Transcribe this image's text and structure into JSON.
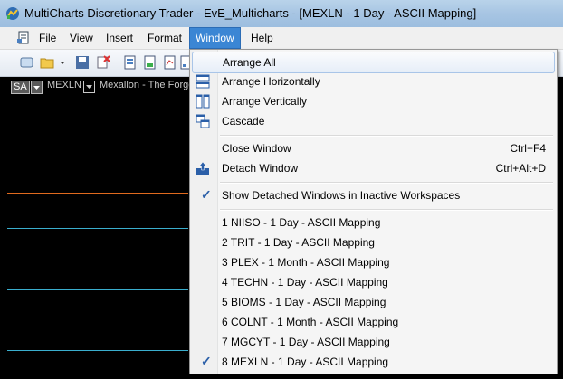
{
  "window": {
    "title": "MultiCharts Discretionary Trader - EvE_Multicharts - [MEXLN - 1 Day - ASCII Mapping]"
  },
  "menubar": {
    "items": [
      {
        "label": "File"
      },
      {
        "label": "View"
      },
      {
        "label": "Insert"
      },
      {
        "label": "Format"
      },
      {
        "label": "Window"
      },
      {
        "label": "Help"
      }
    ]
  },
  "chart": {
    "mode_badge": "SA",
    "symbol": "MEXLN",
    "symbol_description": "Mexallon - The Forge"
  },
  "window_menu": {
    "items": [
      {
        "label": "Arrange All",
        "icon": "arrange-all-icon"
      },
      {
        "label": "Arrange Horizontally",
        "icon": "arrange-horizontal-icon"
      },
      {
        "label": "Arrange Vertically",
        "icon": "arrange-vertical-icon"
      },
      {
        "label": "Cascade",
        "icon": "cascade-icon"
      },
      {
        "label": "Close Window",
        "shortcut": "Ctrl+F4"
      },
      {
        "label": "Detach Window",
        "shortcut": "Ctrl+Alt+D",
        "icon": "detach-window-icon"
      },
      {
        "label": "Show Detached Windows in Inactive Workspaces",
        "checked": true
      },
      {
        "label": "1 NIISO - 1 Day - ASCII Mapping"
      },
      {
        "label": "2 TRIT - 1 Day - ASCII Mapping"
      },
      {
        "label": "3 PLEX - 1 Month - ASCII Mapping"
      },
      {
        "label": "4 TECHN - 1 Day - ASCII Mapping"
      },
      {
        "label": "5 BIOMS - 1 Day - ASCII Mapping"
      },
      {
        "label": "6 COLNT - 1 Month - ASCII Mapping"
      },
      {
        "label": "7 MGCYT - 1 Day - ASCII Mapping"
      },
      {
        "label": "8 MEXLN - 1 Day - ASCII Mapping",
        "checked": true
      }
    ]
  },
  "colors": {
    "chart_bg": "#000000",
    "line_orange": "#e06a1e",
    "line_cyan": "#3aaecd",
    "menu_highlight": "#3b86d4"
  }
}
